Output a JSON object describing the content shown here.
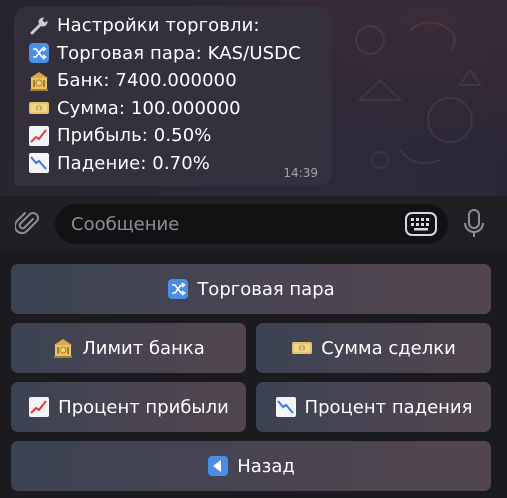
{
  "message": {
    "lines": [
      {
        "icon": "wrench-icon",
        "text": "Настройки торговли:"
      },
      {
        "icon": "shuffle-icon",
        "text": "Торговая пара: KAS/USDC"
      },
      {
        "icon": "bank-icon",
        "text": "Банк: 7400.000000"
      },
      {
        "icon": "money-icon",
        "text": "Сумма: 100.000000"
      },
      {
        "icon": "chart-up-icon",
        "text": "Прибыль: 0.50%"
      },
      {
        "icon": "chart-down-icon",
        "text": "Падение: 0.70%"
      }
    ],
    "time": "14:39"
  },
  "composer": {
    "placeholder": "Сообщение"
  },
  "keyboard": {
    "trading_pair": "Торговая пара",
    "bank_limit": "Лимит банка",
    "trade_amount": "Сумма сделки",
    "profit_percent": "Процент прибыли",
    "drop_percent": "Процент падения",
    "back": "Назад"
  },
  "colors": {
    "bubble": "#34323e",
    "button_left": "#3b4352",
    "button_right": "#51464d",
    "icon_blue": "#4a8ee8",
    "chart_red": "#e23b3b",
    "chart_blue": "#3e78d8"
  }
}
